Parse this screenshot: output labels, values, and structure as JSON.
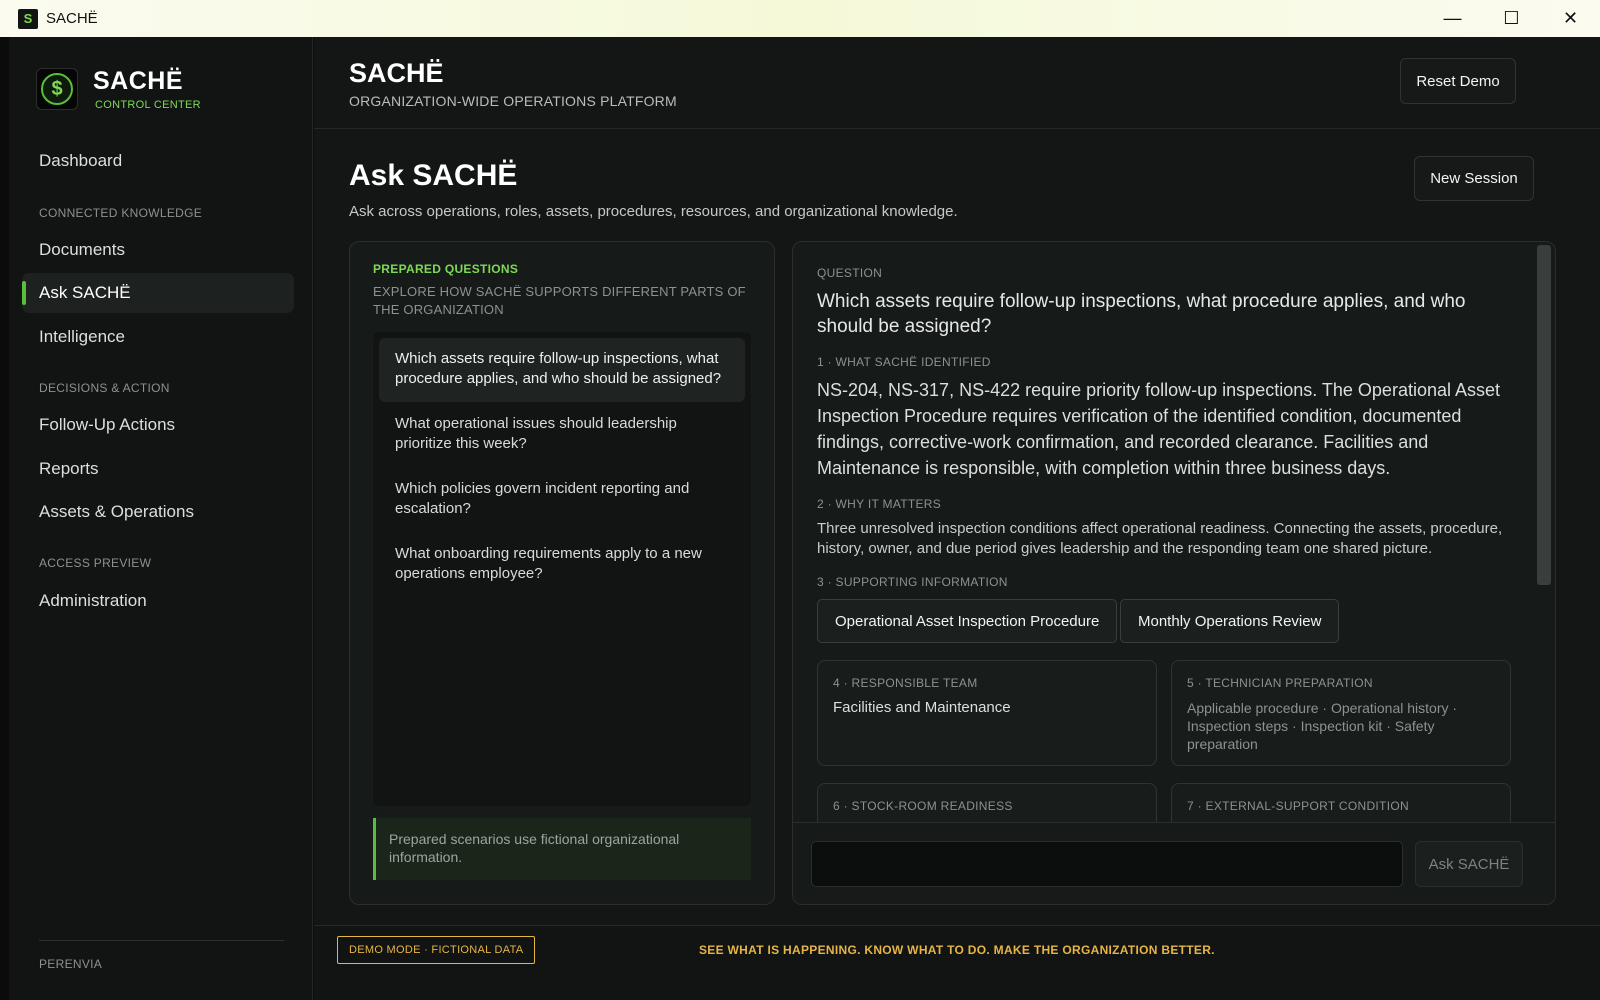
{
  "window": {
    "title": "SACHË",
    "logo_glyph": "S",
    "minimize_glyph": "—",
    "maximize_glyph": "☐",
    "close_glyph": "✕"
  },
  "sidebar": {
    "brand_name": "SACHË",
    "brand_sub": "CONTROL CENTER",
    "brand_glyph": "$",
    "dashboard": "Dashboard",
    "section_connected": "CONNECTED KNOWLEDGE",
    "documents": "Documents",
    "ask": "Ask SACHË",
    "intelligence": "Intelligence",
    "section_decisions": "DECISIONS & ACTION",
    "follow_up": "Follow-Up Actions",
    "reports": "Reports",
    "assets_ops": "Assets & Operations",
    "section_access": "ACCESS PREVIEW",
    "administration": "Administration",
    "footer": "PERENVIA"
  },
  "header": {
    "title": "SACHË",
    "subtitle": "ORGANIZATION-WIDE OPERATIONS PLATFORM",
    "reset_button": "Reset Demo"
  },
  "page": {
    "title": "Ask SACHË",
    "subtitle": "Ask across operations, roles, assets, procedures, resources, and organizational knowledge.",
    "new_session_button": "New Session"
  },
  "prepared": {
    "label": "PREPARED QUESTIONS",
    "subtitle": "EXPLORE HOW SACHË SUPPORTS DIFFERENT PARTS OF THE ORGANIZATION",
    "questions": [
      "Which assets require follow-up inspections, what procedure applies, and who should be assigned?",
      "What operational issues should leadership prioritize this week?",
      "Which policies govern incident reporting and escalation?",
      "What onboarding requirements apply to a new operations employee?"
    ],
    "note": "Prepared scenarios use fictional organizational information."
  },
  "answer": {
    "question_label": "QUESTION",
    "question": "Which assets require follow-up inspections, what procedure applies, and who should be assigned?",
    "identified_label": "1 · WHAT SACHË IDENTIFIED",
    "identified": "NS-204, NS-317, NS-422 require priority follow-up inspections. The Operational Asset Inspection Procedure requires verification of the identified condition, documented findings, corrective-work confirmation, and recorded clearance. Facilities and Maintenance is responsible, with completion within three business days.",
    "why_label": "2 · WHY IT MATTERS",
    "why": "Three unresolved inspection conditions affect operational readiness. Connecting the assets, procedure, history, owner, and due period gives leadership and the responding team one shared picture.",
    "supporting_label": "3 · SUPPORTING INFORMATION",
    "supporting": [
      "Operational Asset Inspection Procedure",
      "Monthly Operations Review"
    ],
    "team_label": "4 · RESPONSIBLE TEAM",
    "team": "Facilities and Maintenance",
    "prep_label": "5 · TECHNICIAN PREPARATION",
    "prep": "Applicable procedure · Operational history · Inspection steps · Inspection kit · Safety preparation",
    "stock_label": "6 · STOCK-ROOM READINESS",
    "external_label": "7 · EXTERNAL-SUPPORT CONDITION",
    "ask_button": "Ask SACHË"
  },
  "footer": {
    "demo_badge": "DEMO MODE · FICTIONAL DATA",
    "tagline": "SEE WHAT IS HAPPENING. KNOW WHAT TO DO. MAKE THE ORGANIZATION BETTER."
  }
}
